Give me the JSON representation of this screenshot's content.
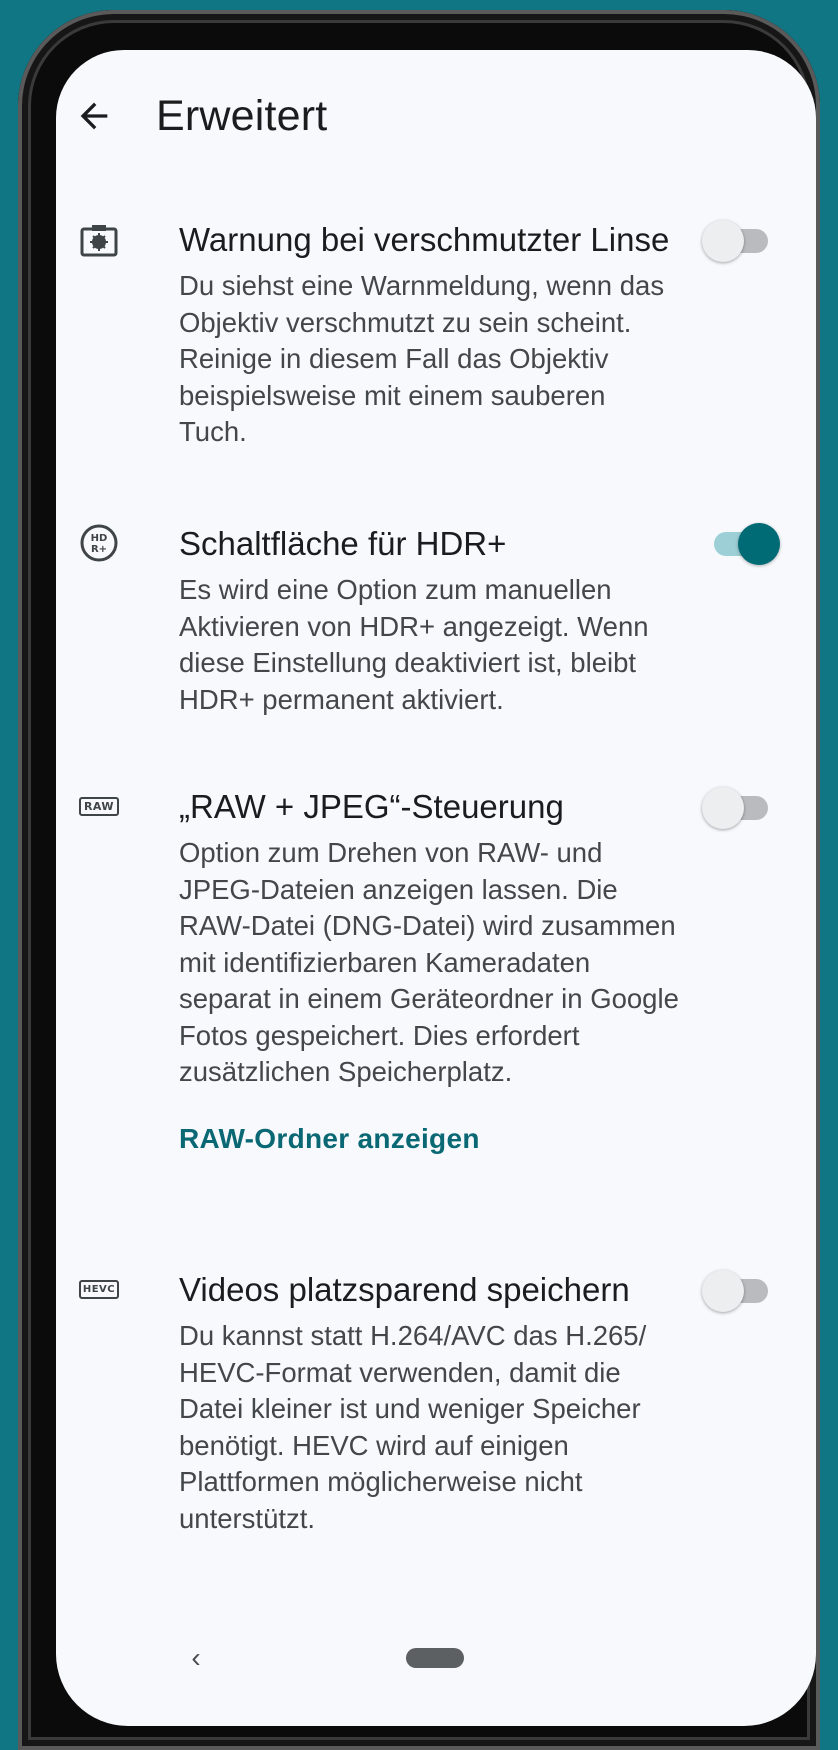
{
  "app_bar": {
    "back_icon": "arrow-back-icon",
    "title": "Erweitert"
  },
  "settings": [
    {
      "icon": "dirty-lens-icon",
      "title": "Warnung bei verschmutzter Linse",
      "description": "Du siehst eine Warnmeldung, wenn das Objektiv verschmutzt zu sein scheint. Reinige in diesem Fall das Objektiv beispielsweise mit einem sauberen Tuch.",
      "enabled": false
    },
    {
      "icon": "hdr-plus-icon",
      "icon_text": "HD R+",
      "title": "Schaltfläche für HDR+",
      "description": "Es wird eine Option zum manuellen Aktivieren von HDR+ angezeigt. Wenn diese Einstellung deaktiviert ist, bleibt HDR+ permanent aktiviert.",
      "enabled": true
    },
    {
      "icon": "raw-icon",
      "icon_text": "RAW",
      "title": "„RAW + JPEG“-Steuerung",
      "description": "Option zum Drehen von RAW- und JPEG-Dateien anzeigen lassen. Die RAW-Datei (DNG-Datei) wird zusammen mit identifizierbaren Kameradaten separat in einem Geräteordner in Google Fotos gespeichert. Dies erfordert zusätzlichen Speicherplatz.",
      "link": "RAW-Ordner anzeigen",
      "enabled": false
    },
    {
      "icon": "hevc-icon",
      "icon_text": "HEVC",
      "title": "Videos platzsparend speichern",
      "description": "Du kannst statt H.264/AVC das H.265/ HEVC-Format verwenden, damit die Datei kleiner ist und weniger Speicher benötigt. HEVC wird auf einigen Plattformen möglicherweise nicht unterstützt.",
      "enabled": false
    }
  ],
  "nav_bar": {
    "back_glyph": "‹",
    "home_icon": "home-pill-icon"
  },
  "colors": {
    "background": "#117684",
    "screen": "#f7f9fc",
    "accent": "#006a75",
    "link": "#0a6874"
  }
}
